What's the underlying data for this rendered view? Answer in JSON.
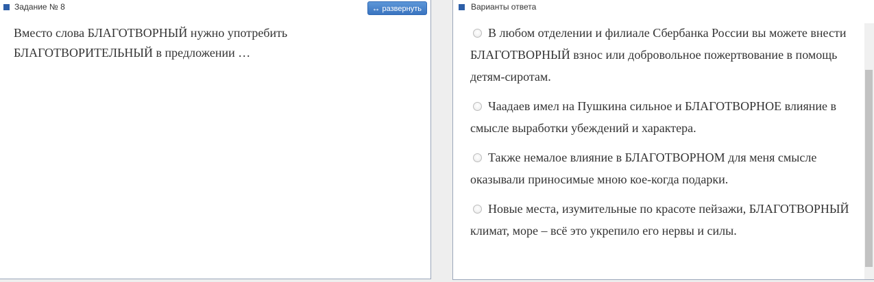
{
  "left_panel": {
    "title": "Задание № 8",
    "expand_button": {
      "icon": "↔",
      "label": "развернуть"
    },
    "question": "Вместо слова БЛАГОТВОРНЫЙ нужно употребить БЛАГОТВОРИТЕЛЬНЫЙ в предложении …"
  },
  "right_panel": {
    "title": "Варианты ответа",
    "options": [
      "В любом отделении и филиале Сбербанка России вы можете внести БЛАГОТВОРНЫЙ взнос или добровольное пожертвование в помощь детям-сиротам.",
      "Чаадаев имел на Пушкина сильное и БЛАГОТВОРНОЕ влияние в смысле выработки убеждений и характера.",
      "Также немалое влияние в БЛАГОТВОРНОМ для меня смысле оказывали приносимые мною кое-когда подарки.",
      "Новые места, изумительные по красоте пейзажи, БЛАГОТВОРНЫЙ климат, море – всё это укрепило его нервы и силы."
    ]
  },
  "colors": {
    "header_marker": "#2d5fa8",
    "button": "#3a74c0",
    "text": "#333333",
    "panel_border": "#9aa6ba"
  }
}
